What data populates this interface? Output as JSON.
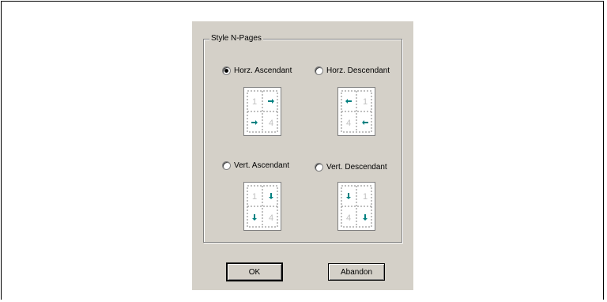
{
  "dialog": {
    "group_title": "Style N-Pages",
    "options": [
      {
        "label": "Horz. Ascendant",
        "checked": true
      },
      {
        "label": "Horz. Descendant",
        "checked": false
      },
      {
        "label": "Vert. Ascendant",
        "checked": false
      },
      {
        "label": "Vert. Descendant",
        "checked": false
      }
    ],
    "previews": [
      {
        "numbers": [
          "1",
          "4"
        ],
        "arrows": [
          "right-arrow-icon",
          "right-arrow-icon"
        ]
      },
      {
        "numbers": [
          "1",
          "4"
        ],
        "arrows": [
          "left-arrow-icon",
          "left-arrow-icon"
        ]
      },
      {
        "numbers": [
          "1",
          "4"
        ],
        "arrows": [
          "down-arrow-icon",
          "down-arrow-icon"
        ]
      },
      {
        "numbers": [
          "1",
          "4"
        ],
        "arrows": [
          "down-arrow-icon",
          "down-arrow-icon"
        ]
      }
    ],
    "ok_label": "OK",
    "cancel_label": "Abandon"
  },
  "colors": {
    "arrow": "#008080",
    "page_number": "#c0c0c0",
    "dialog_bg": "#d4d0c8"
  }
}
